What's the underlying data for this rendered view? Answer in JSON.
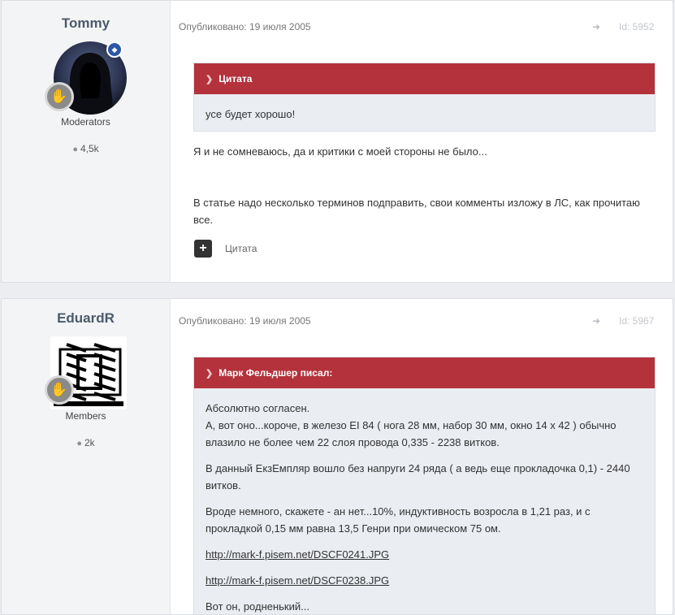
{
  "posts": [
    {
      "author": "Tommy",
      "group": "Moderators",
      "post_count": "4,5k",
      "published": "Опубликовано: 19 июля 2005",
      "post_id": "Id: 5952",
      "quote_header": "Цитата",
      "quote_paragraphs": [
        "усе будет хорошо!"
      ],
      "body_paragraphs": [
        "Я и не сомневаюсь, да и критики с моей стороны не было...",
        "В статье надо несколько терминов подправить, свои комменты изложу в ЛС, как прочитаю все."
      ],
      "quote_action": "Цитата"
    },
    {
      "author": "EduardR",
      "group": "Members",
      "post_count": "2k",
      "published": "Опубликовано: 19 июля 2005",
      "post_id": "Id: 5967",
      "quote_header": "Марк Фельдшер писал:",
      "quote_paragraphs": [
        "Абсолютно согласен.",
        "А, вот оно...короче, в железо EI 84 ( нога 28 мм, набор 30 мм, окно 14 х 42 ) обычно влазило не более чем 22 слоя провода 0,335 - 2238 витков.",
        "В данный ЕкзЕмпляр вошло без напруги 24 ряда ( а ведь еще прокладочка 0,1) - 2440 витков.",
        "Вроде немного, скажете - ан нет...10%, индуктивность возросла в 1,21 раз, и с прокладкой 0,15 мм равна 13,5 Генри при омическом 75 ом.",
        "http://mark-f.pisem.net/DSCF0241.JPG",
        "http://mark-f.pisem.net/DSCF0238.JPG",
        "Вот он, родненький..."
      ]
    }
  ],
  "colors": {
    "quote_header_bg": "#b3323c",
    "quote_bg": "#eaedf2",
    "author_name": "#4b5a6b",
    "moderator_badge": "#2d58a8"
  },
  "icons": {
    "comment": "comment-icon",
    "share": "share-icon",
    "quote_chevron": "chevron-down-icon",
    "plus": "plus-icon"
  }
}
